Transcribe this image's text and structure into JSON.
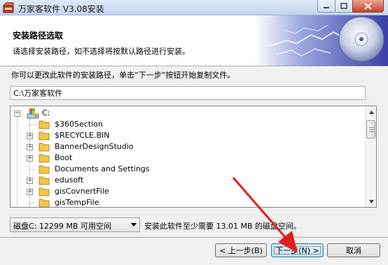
{
  "window": {
    "title": "万家客软件 V3.08安装",
    "app_icon": "installer-box-icon",
    "controls": {
      "minimize": "minimize-icon",
      "maximize": "maximize-icon",
      "close": "close-icon"
    }
  },
  "header": {
    "title": "安装路径选取",
    "subtitle": "请选择安装路径，如不选择将按默认路径进行安装。",
    "art": "cd-disc-lightning-art"
  },
  "instruction": "你可以更改此软件的安装路径，单击“下一步”按钮开始复制文件。",
  "path_input": {
    "value": "C:\\万家客软件"
  },
  "tree": {
    "root": {
      "label": "C:",
      "expanded": true,
      "icon": "computer-drive-icon"
    },
    "items": [
      {
        "label": "$360Section",
        "has_children": false
      },
      {
        "label": "$RECYCLE.BIN",
        "has_children": true
      },
      {
        "label": "BannerDesignStudio",
        "has_children": true
      },
      {
        "label": "Boot",
        "has_children": true
      },
      {
        "label": "Documents and Settings",
        "has_children": false
      },
      {
        "label": "edusoft",
        "has_children": true
      },
      {
        "label": "gisCovnertFile",
        "has_children": true
      },
      {
        "label": "gisTempFile",
        "has_children": false
      }
    ]
  },
  "drive_select": {
    "value": "磁盘C:   12299 MB 可用空间"
  },
  "space_required": "安装此软件至少需要 13.01 MB 的磁盘空间。",
  "buttons": {
    "back": "< 上一步(B)",
    "next": "下一步(N) >",
    "cancel": "取消"
  },
  "colors": {
    "annotation_arrow": "#e0201c",
    "focused_button_border": "#3c7fb1"
  }
}
